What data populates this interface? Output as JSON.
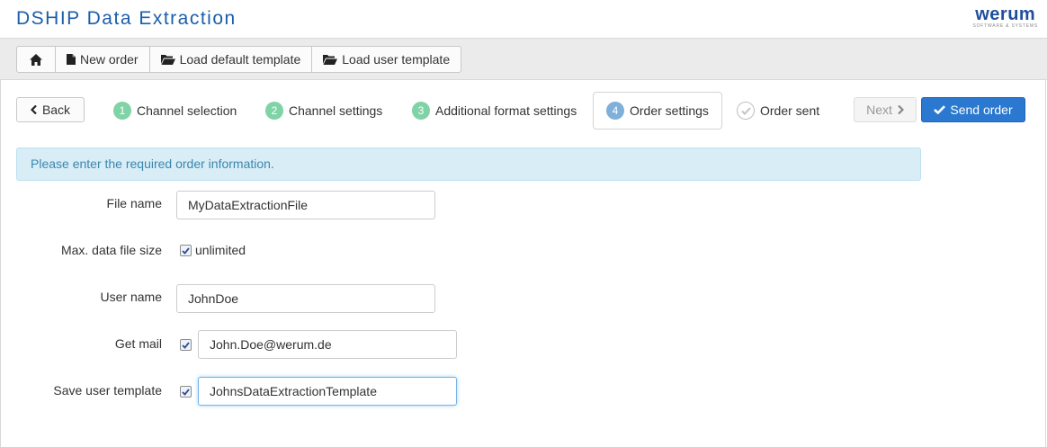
{
  "header": {
    "title": "DSHIP Data Extraction",
    "logo_text": "werum",
    "logo_subtext": "SOFTWARE & SYSTEMS"
  },
  "toolbar": {
    "home_icon": "home-icon",
    "new_order_label": "New order",
    "load_default_label": "Load default template",
    "load_user_label": "Load user template"
  },
  "wizard": {
    "back_label": "Back",
    "steps": [
      {
        "number": "1",
        "label": "Channel selection",
        "state": "done"
      },
      {
        "number": "2",
        "label": "Channel settings",
        "state": "done"
      },
      {
        "number": "3",
        "label": "Additional format settings",
        "state": "done"
      },
      {
        "number": "4",
        "label": "Order settings",
        "state": "active"
      },
      {
        "number": "",
        "label": "Order sent",
        "state": "pending"
      }
    ],
    "next_label": "Next",
    "send_label": "Send order"
  },
  "alert": {
    "message": "Please enter the required order information."
  },
  "form": {
    "file_name": {
      "label": "File name",
      "value": "MyDataExtractionFile"
    },
    "max_size": {
      "label": "Max. data file size",
      "checkbox_label": "unlimited",
      "checked": true
    },
    "user_name": {
      "label": "User name",
      "value": "JohnDoe"
    },
    "get_mail": {
      "label": "Get mail",
      "checked": true,
      "value": "John.Doe@werum.de"
    },
    "save_template": {
      "label": "Save user template",
      "checked": true,
      "value": "JohnsDataExtractionTemplate"
    }
  },
  "colors": {
    "accent": "#2a78cf",
    "title": "#1a5eab",
    "step_done": "#7fd3a6",
    "step_active": "#7eb0d9",
    "alert_bg": "#d9edf7",
    "alert_text": "#3a87ad"
  }
}
